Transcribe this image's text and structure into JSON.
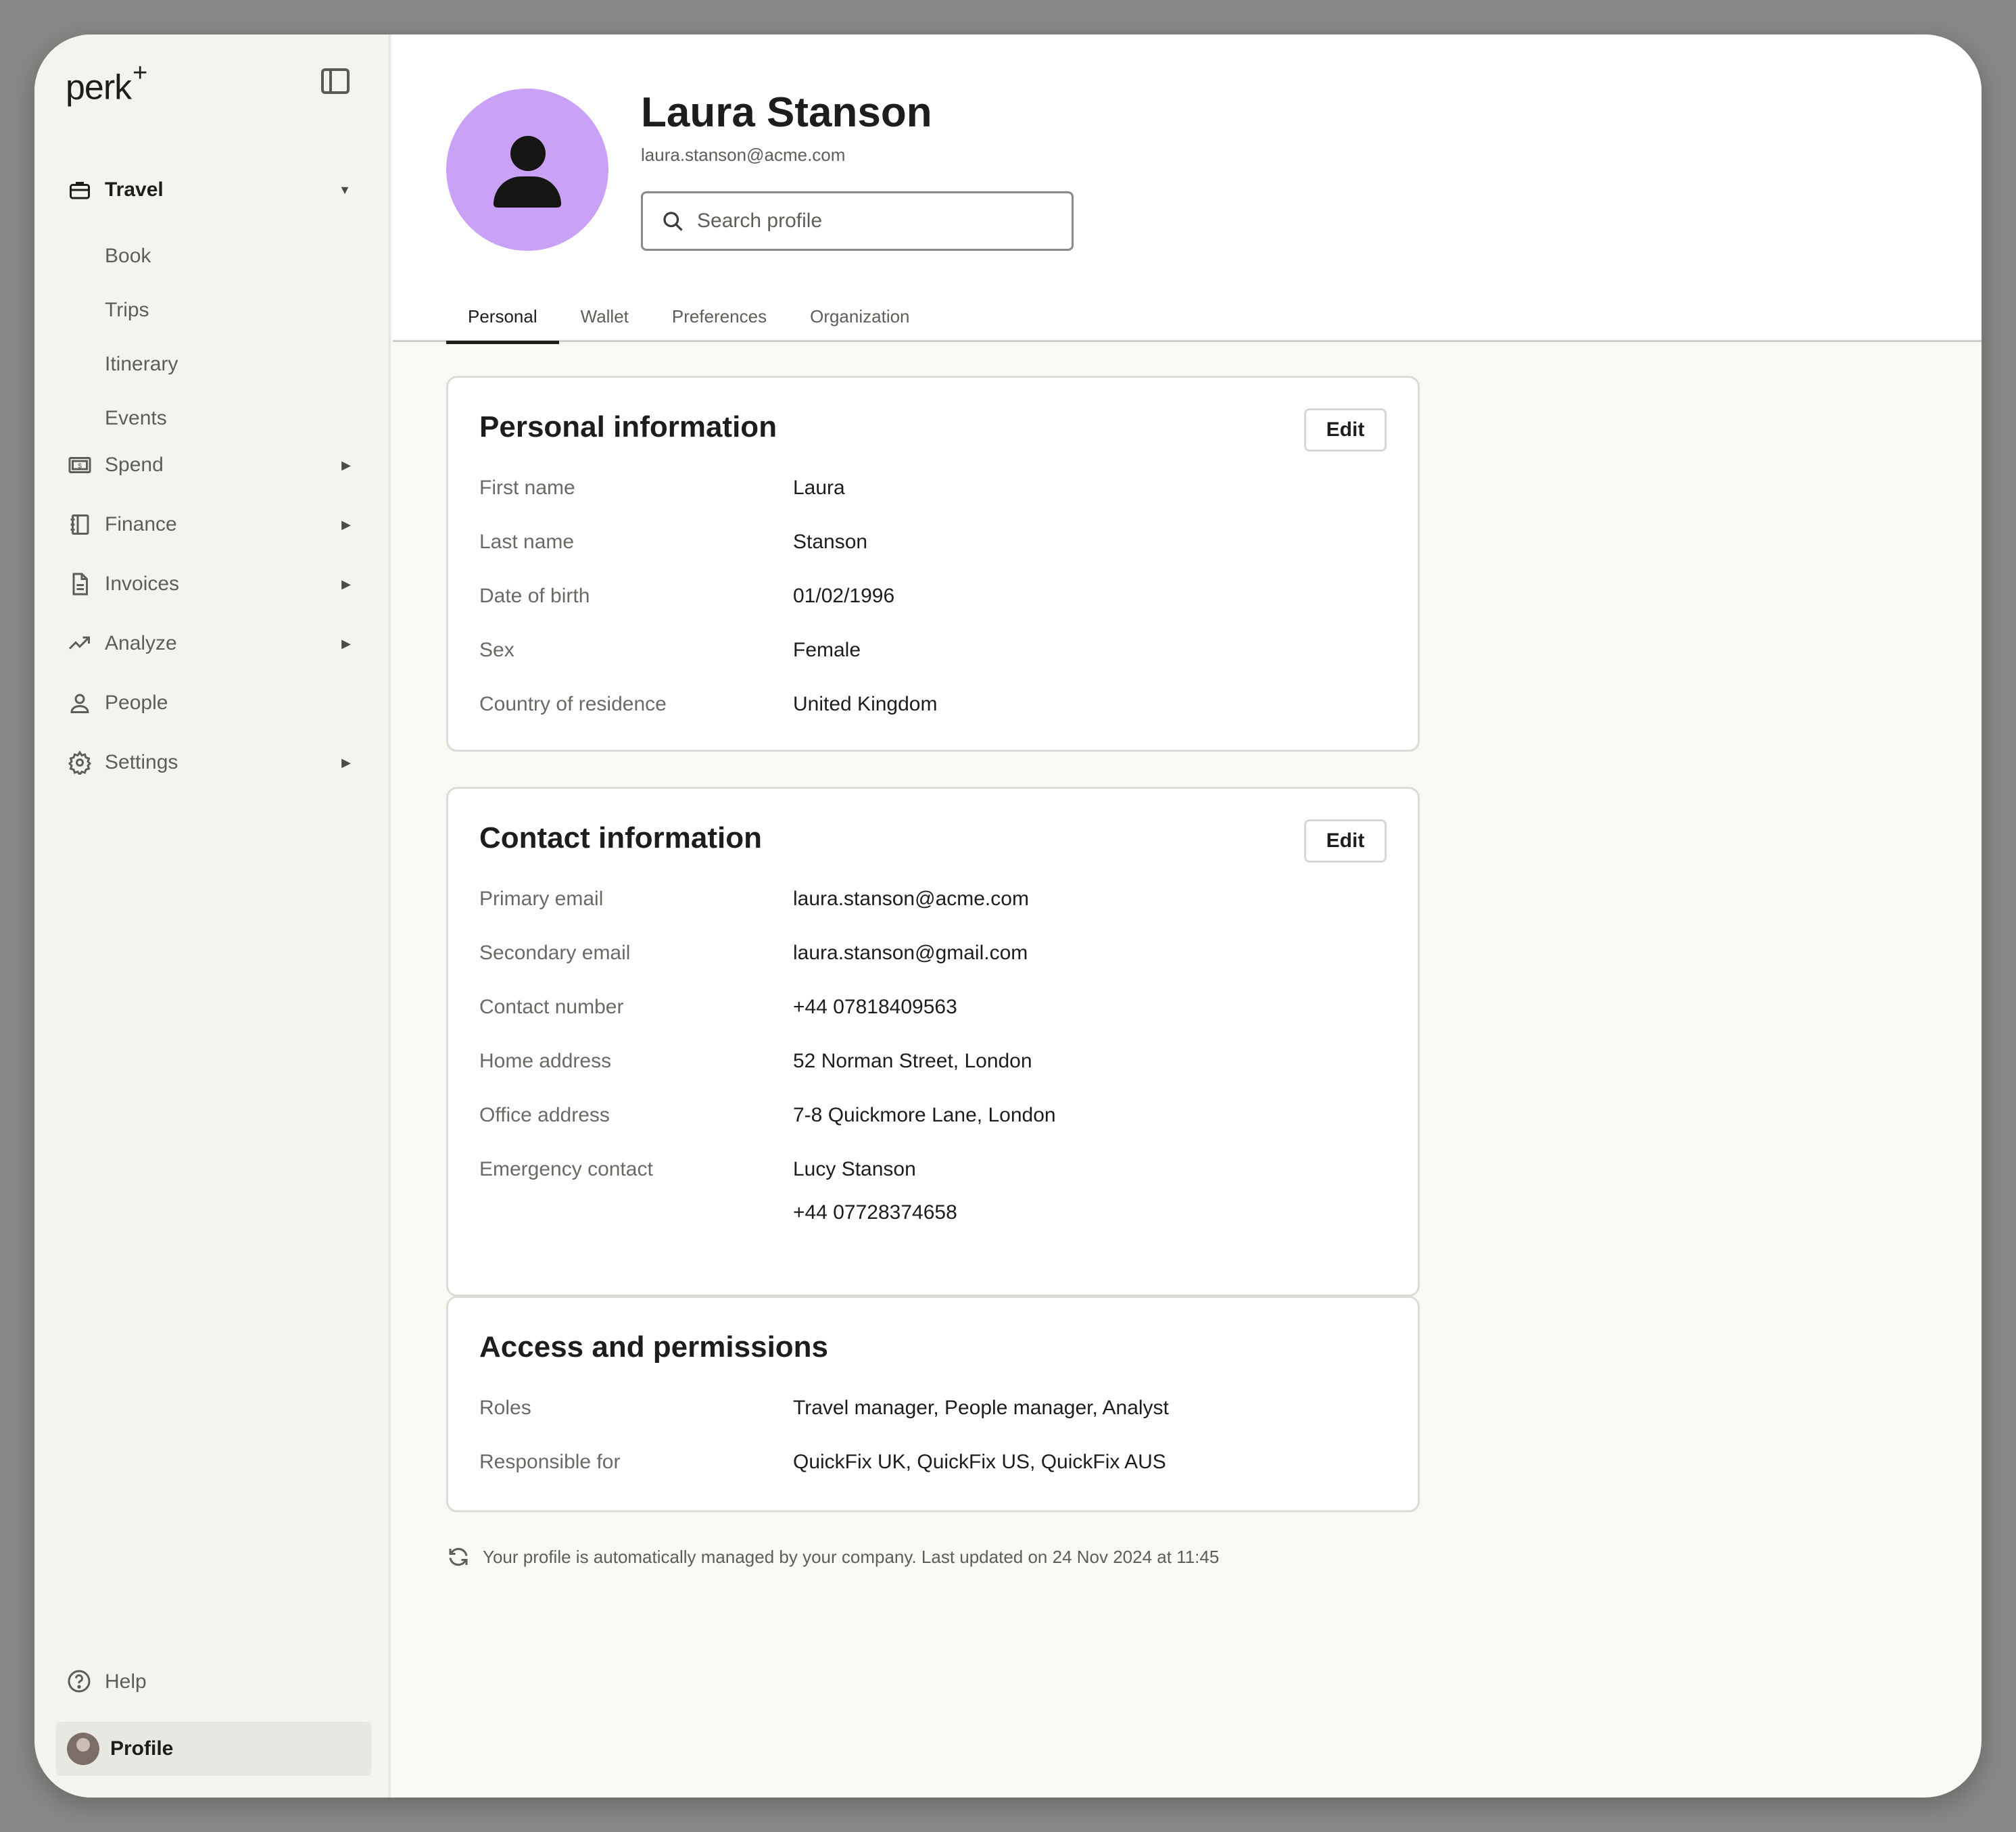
{
  "app": {
    "logo": "perk",
    "logo_mark": "+"
  },
  "sidebar": {
    "items": [
      {
        "label": "Travel",
        "icon": "briefcase-icon",
        "expanded": true
      },
      {
        "label": "Spend",
        "icon": "money-icon"
      },
      {
        "label": "Finance",
        "icon": "ledger-icon"
      },
      {
        "label": "Invoices",
        "icon": "document-icon"
      },
      {
        "label": "Analyze",
        "icon": "trend-icon"
      },
      {
        "label": "People",
        "icon": "person-icon"
      },
      {
        "label": "Settings",
        "icon": "gear-icon"
      }
    ],
    "travel_sub": [
      "Book",
      "Trips",
      "Itinerary",
      "Events"
    ],
    "help": "Help",
    "profile": "Profile"
  },
  "user": {
    "name": "Laura Stanson",
    "email": "laura.stanson@acme.com",
    "avatar_color": "#c9a2f8"
  },
  "search": {
    "placeholder": "Search profile"
  },
  "tabs": [
    "Personal",
    "Wallet",
    "Preferences",
    "Organization"
  ],
  "personal": {
    "title": "Personal information",
    "edit": "Edit",
    "rows": [
      {
        "label": "First name",
        "value": "Laura"
      },
      {
        "label": "Last name",
        "value": "Stanson"
      },
      {
        "label": "Date of birth",
        "value": "01/02/1996"
      },
      {
        "label": "Sex",
        "value": "Female"
      },
      {
        "label": "Country of residence",
        "value": "United Kingdom"
      }
    ]
  },
  "contact": {
    "title": "Contact information",
    "edit": "Edit",
    "rows": [
      {
        "label": "Primary email",
        "value": "laura.stanson@acme.com"
      },
      {
        "label": "Secondary email",
        "value": "laura.stanson@gmail.com"
      },
      {
        "label": "Contact number",
        "value": "+44 07818409563"
      },
      {
        "label": "Home address",
        "value": "52 Norman Street, London"
      },
      {
        "label": "Office address",
        "value": "7-8 Quickmore Lane, London"
      },
      {
        "label": "Emergency contact",
        "value": "Lucy Stanson",
        "value2": "+44 07728374658"
      }
    ]
  },
  "access": {
    "title": "Access and permissions",
    "rows": [
      {
        "label": "Roles",
        "value": "Travel manager, People manager, Analyst"
      },
      {
        "label": "Responsible for",
        "value": "QuickFix UK, QuickFix US, QuickFix AUS"
      }
    ]
  },
  "footer": {
    "note": "Your profile is automatically managed by your company. Last updated on 24 Nov 2024 at 11:45"
  }
}
